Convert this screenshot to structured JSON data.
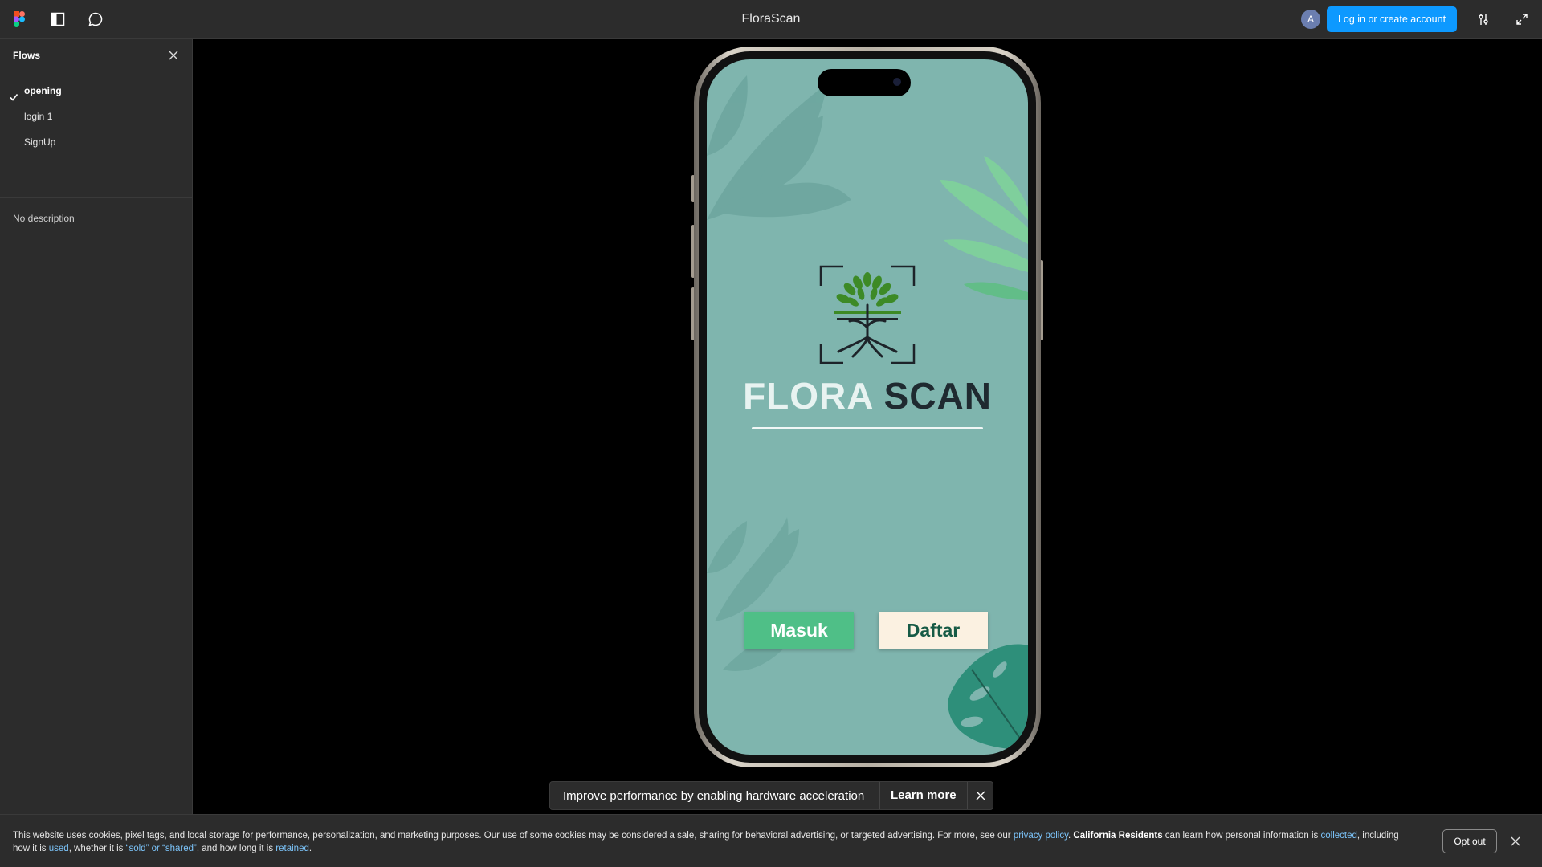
{
  "header": {
    "title": "FloraScan",
    "avatar_initial": "A",
    "login_label": "Log in or create account",
    "icons": [
      "figma-logo-icon",
      "sidebar-toggle-icon",
      "comment-icon",
      "settings-sliders-icon",
      "expand-icon"
    ]
  },
  "sidebar": {
    "title": "Flows",
    "flows": [
      {
        "label": "opening",
        "active": true
      },
      {
        "label": "login 1",
        "active": false
      },
      {
        "label": "SignUp",
        "active": false
      }
    ],
    "description": "No description"
  },
  "prototype": {
    "brand_word1": "FLORA",
    "brand_word2": "SCAN",
    "masuk_label": "Masuk",
    "daftar_label": "Daftar",
    "colors": {
      "screen_bg": "#7fb5ae",
      "masuk_bg": "#4fbf87",
      "daftar_bg": "#fbf1e1"
    }
  },
  "toast": {
    "message": "Improve performance by enabling hardware acceleration",
    "learn_more": "Learn more"
  },
  "cookie": {
    "text1": "This website uses cookies, pixel tags, and local storage for performance, personalization, and marketing purposes. Our use of some cookies may be considered a sale, sharing for behavioral advertising, or targeted advertising. For more, see our ",
    "link_privacy": "privacy policy",
    "text2": ". ",
    "bold_ca": "California Residents",
    "text3": " can learn how personal information is ",
    "link_collected": "collected",
    "text4": ", including how it is ",
    "link_used": "used",
    "text5": ", whether it is ",
    "link_sold": "“sold” or “shared”",
    "text6": ", and how long it is ",
    "link_retained": "retained",
    "text7": ".",
    "opt_out": "Opt out"
  }
}
